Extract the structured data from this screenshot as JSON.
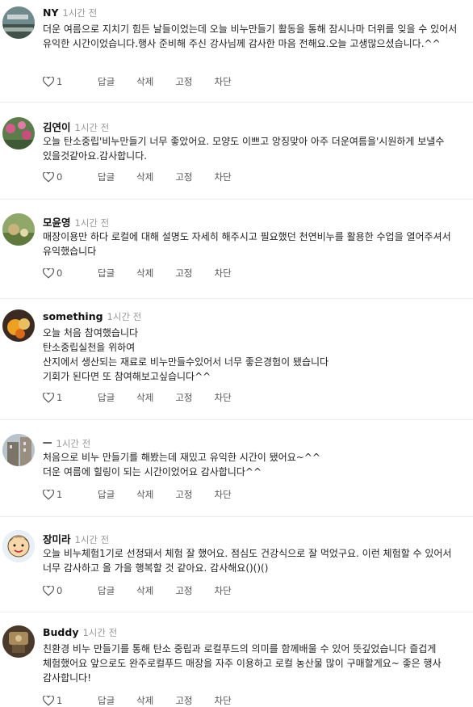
{
  "comments": [
    {
      "author": "NY",
      "time": "1시간 전",
      "likes": "1",
      "lines": [
        "더운 여름으로 지치기 힘든 날들이었는데 오늘 비누만들기 활동을 통해 잠시나마 더위를 잊을 수 있어서 유익한 시간이었습니다.행사 준비해 주신 강사님께 감사한 마음 전해요.오늘 고생많으셨습니다.^^"
      ]
    },
    {
      "author": "김연이",
      "time": "1시간 전",
      "likes": "0",
      "lines": [
        "오늘 탄소중립'비누만들기 너무 좋았어요. 모양도 이쁘고 앙징맞아   아주 더운여름을'시원하게 보낼수 있을것같아요.감사합니다."
      ]
    },
    {
      "author": "모윤영",
      "time": "1시간 전",
      "likes": "0",
      "lines": [
        "매장이용만 하다 로컬에 대해 설명도 자세히 해주시고 필요했던 천연비누를 활용한 수업을 열어주셔서 유익했습니다"
      ]
    },
    {
      "author": "something",
      "time": "1시간 전",
      "likes": "1",
      "lines": [
        "오늘 처음 참여했습니다",
        "탄소중립실천을 위하여",
        "산지에서 생산되는 재료로 비누만들수있어서 너무 좋은경험이 됐습니다",
        "기회가 된다면 또 참여해보고싶습니다^^"
      ]
    },
    {
      "author": "ㅡ",
      "time": "1시간 전",
      "likes": "1",
      "lines": [
        "처음으로 비누 만들기를 해봤는데 재밌고 유익한 시간이 됐어요~^^",
        "더운 여름에 힐링이 되는 시간이었어요 감사합니다^^"
      ]
    },
    {
      "author": "장미라",
      "time": "1시간 전",
      "likes": "0",
      "lines": [
        "오늘 비누체험1기로 선정돼서 체험 잘 했어요. 점심도 건강식으로 잘 먹었구요. 이런 체험할 수 있어서 너무 감사하고 올 가을 행복할 것 같아요. 감사해요()()()"
      ]
    },
    {
      "author": "Buddy",
      "time": "1시간 전",
      "likes": "1",
      "lines": [
        "친환경 비누 만들기를 통해 탄소 중립과 로컬푸드의 의미를 함께배울 수 있어 뜻깊었습니다 즐겁게 체험했어요 앞으로도 완주로컬푸드 매장을 자주 이용하고 로컬 농산물 많이 구매할게요~ 좋은 행사 감사합니다!"
      ]
    }
  ],
  "actions": {
    "reply": "답글",
    "delete": "삭제",
    "pin": "고정",
    "block": "차단"
  },
  "icons": {
    "like": "heart-outline-icon"
  }
}
